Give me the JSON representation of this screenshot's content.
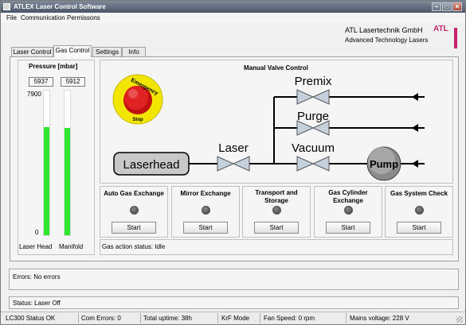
{
  "window": {
    "title": "ATLEX Laser Control Software",
    "minimize": "–",
    "maximize": "□",
    "close": "✕"
  },
  "menu": [
    "File",
    "Communication",
    "Permissons"
  ],
  "header": {
    "company": "ATL Lasertechnik GmbH",
    "tagline": "Advanced Technology Lasers",
    "logo_text": "ATL"
  },
  "tabs": [
    "Laser Control",
    "Gas Control",
    "Settings",
    "Info"
  ],
  "active_tab": "Gas Control",
  "pressure": {
    "title": "Pressure [mbar]",
    "scale_max": "7900",
    "scale_min": "0",
    "laser_head": {
      "value": "5937",
      "label": "Laser Head",
      "level": 0.75
    },
    "manifold": {
      "value": "5912",
      "label": "Manifold",
      "level": 0.74
    }
  },
  "valve_control": {
    "title": "Manual Valve Control",
    "emergency": {
      "line1": "Emergency",
      "line2": "Stop"
    },
    "laserhead_label": "Laserhead",
    "laser_valve_label": "Laser",
    "premix_label": "Premix",
    "purge_label": "Purge",
    "vacuum_label": "Vacuum",
    "pump_label": "Pump"
  },
  "operations": [
    {
      "title": "Auto Gas Exchange",
      "button": "Start"
    },
    {
      "title": "Mirror Exchange",
      "button": "Start"
    },
    {
      "title": "Transport and Storage",
      "button": "Start"
    },
    {
      "title": "Gas Cylinder Exchange",
      "button": "Start"
    },
    {
      "title": "Gas System Check",
      "button": "Start"
    }
  ],
  "gas_action_status": "Gas action status: Idle",
  "errors": "Errors: No errors",
  "status": "Status: Laser Off",
  "statusbar": [
    "LC300 Status OK",
    "Com Errors: 0",
    "Total uptime: 38h",
    "KrF Mode",
    "Fan Speed: 0 rpm",
    "Mains voltage: 228 V"
  ],
  "colors": {
    "bar_fill": "#2ee62e",
    "emergency_ring": "#f2e600",
    "emergency_button": "#d81818",
    "logo": "#c8246e"
  }
}
